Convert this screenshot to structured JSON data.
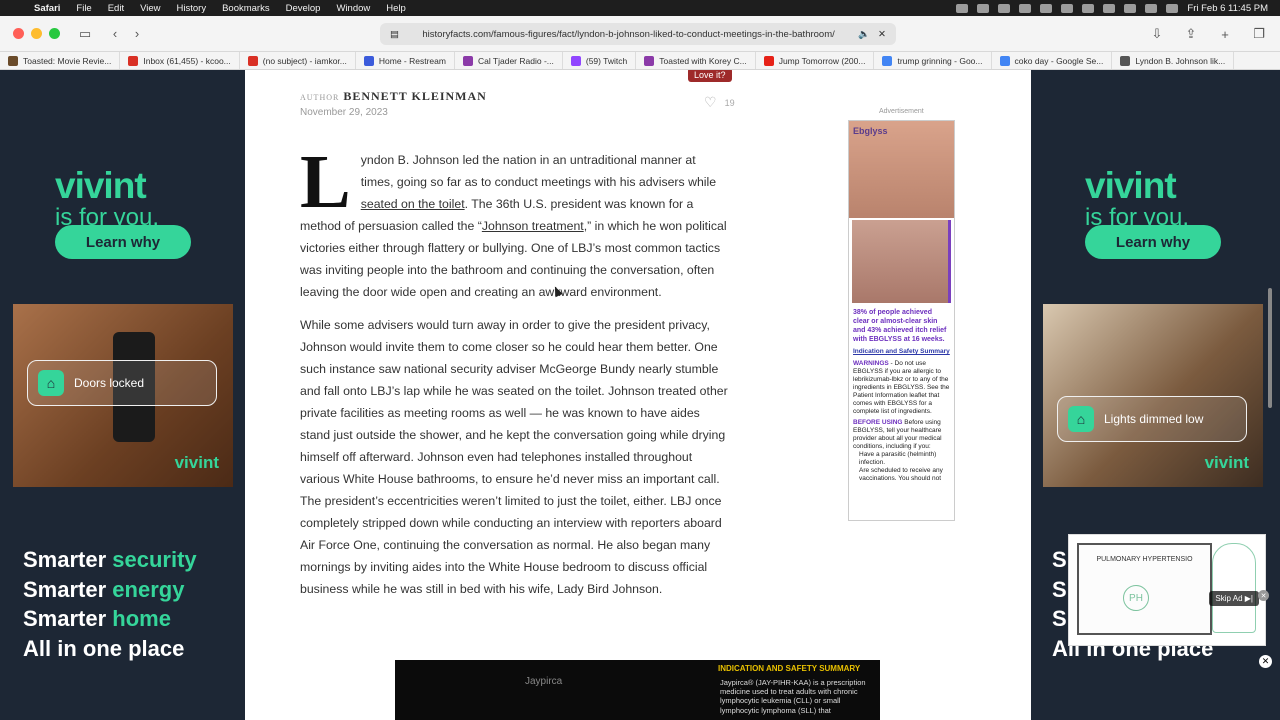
{
  "menubar": {
    "apple": "",
    "items": [
      "Safari",
      "File",
      "Edit",
      "View",
      "History",
      "Bookmarks",
      "Develop",
      "Window",
      "Help"
    ],
    "clock": "Fri Feb 6  11:45 PM"
  },
  "toolbar": {
    "url": "historyfacts.com/famous-figures/fact/lyndon-b-johnson-liked-to-conduct-meetings-in-the-bathroom/"
  },
  "bookmarks": [
    {
      "label": "Toasted: Movie Revie...",
      "color": "#6a4b2a"
    },
    {
      "label": "Inbox (61,455) - kcoo...",
      "color": "#d93025"
    },
    {
      "label": "(no subject) - iamkor...",
      "color": "#d93025"
    },
    {
      "label": "Home - Restream",
      "color": "#3b5bdb"
    },
    {
      "label": "Cal Tjader Radio -...",
      "color": "#8b3aa8"
    },
    {
      "label": "(59) Twitch",
      "color": "#9146ff"
    },
    {
      "label": "Toasted with Korey C...",
      "color": "#8b3aa8"
    },
    {
      "label": "Jump Tomorrow (200...",
      "color": "#e62117"
    },
    {
      "label": "trump grinning - Goo...",
      "color": "#4285f4"
    },
    {
      "label": "coko day - Google Se...",
      "color": "#4285f4"
    },
    {
      "label": "Lyndon B. Johnson lik...",
      "color": "#555555"
    }
  ],
  "left_ad": {
    "logo": "vivint",
    "tagline": "is for you.",
    "cta": "Learn why",
    "pill": "Doors locked",
    "small_logo": "vivint",
    "smarter": [
      {
        "word": "Smarter ",
        "highlight": "security"
      },
      {
        "word": "Smarter ",
        "highlight": "energy"
      },
      {
        "word": "Smarter ",
        "highlight": "home"
      },
      {
        "word": "All in one place",
        "highlight": ""
      }
    ]
  },
  "right_ad": {
    "logo": "vivint",
    "tagline": "is for you.",
    "cta": "Learn why",
    "pill": "Lights dimmed low",
    "small_logo": "vivint",
    "smarter_lines": [
      "S",
      "S",
      "S",
      "All in one place"
    ]
  },
  "article": {
    "author_label": "AUTHOR",
    "author_name": "BENNETT KLEINMAN",
    "date": "November 29, 2023",
    "love_tip": "Love it?",
    "love_count": "19",
    "dropcap": "L",
    "p1_a": "yndon B. Johnson led the nation in an untraditional manner at times, going so far as to conduct meetings with his advisers while ",
    "p1_link1": "seated on the toilet",
    "p1_b": ". The 36th U.S. president was known for a method of persuasion called the “",
    "p1_link2": "Johnson treatment",
    "p1_c": ",” in which he won political victories either through flattery or bullying. One of LBJ’s most common tactics was inviting people into the bathroom and continuing the conversation, often leaving the door wide open and creating an awkward environment.",
    "p2": "While some advisers would turn away in order to give the president privacy, Johnson would invite them to come closer so he could hear them better. One such instance saw national security adviser McGeorge Bundy nearly stumble and fall onto LBJ’s lap while he was seated on the toilet. Johnson treated other private facilities as meeting rooms as well — he was known to have aides stand just outside the shower, and he kept the conversation going while drying himself off afterward. Johnson even had telephones installed throughout various White House bathrooms, to ensure he’d never miss an important call. The president’s eccentricities weren’t limited to just the toilet, either. LBJ once completely stripped down while conducting an interview with reporters aboard Air Force One, continuing the conversation as normal. He also began many mornings by inviting aides into the White House bedroom to discuss official business while he was still in bed with his wife, Lady Bird Johnson."
  },
  "med_ad": {
    "label": "Advertisement",
    "brand": "Ebglyss",
    "stat": "38% of people achieved clear or almost-clear skin and 43% achieved itch relief with EBGLYSS at 16 weeks.",
    "link": "Indication and Safety Summary",
    "warnings_head": "WARNINGS",
    "warnings": " - Do not use EBGLYSS if you are allergic to lebrikizumab-lbkz or to any of the ingredients in EBGLYSS. See the Patient Information leaflet that comes with EBGLYSS for a complete list of ingredients.",
    "before_head": "BEFORE USING",
    "before": " Before using EBGLYSS, tell your healthcare provider about all your medical conditions, including if you:",
    "bullets": [
      "Have a parasitic (helminth) infection.",
      "Are scheduled to receive any vaccinations. You should not"
    ]
  },
  "bottom_ad": {
    "brand": "Jaypirca",
    "isi_head": "INDICATION AND SAFETY SUMMARY",
    "isi_body": "Jaypirca® (JAY-PIHR-KAA) is a prescription medicine used to treat adults with chronic lymphocytic leukemia (CLL) or small lymphocytic lymphoma (SLL) that"
  },
  "video_ad": {
    "board_text": "PULMONARY HYPERTENSIO",
    "circle": "PH",
    "skip": "Skip Ad ▶|"
  }
}
